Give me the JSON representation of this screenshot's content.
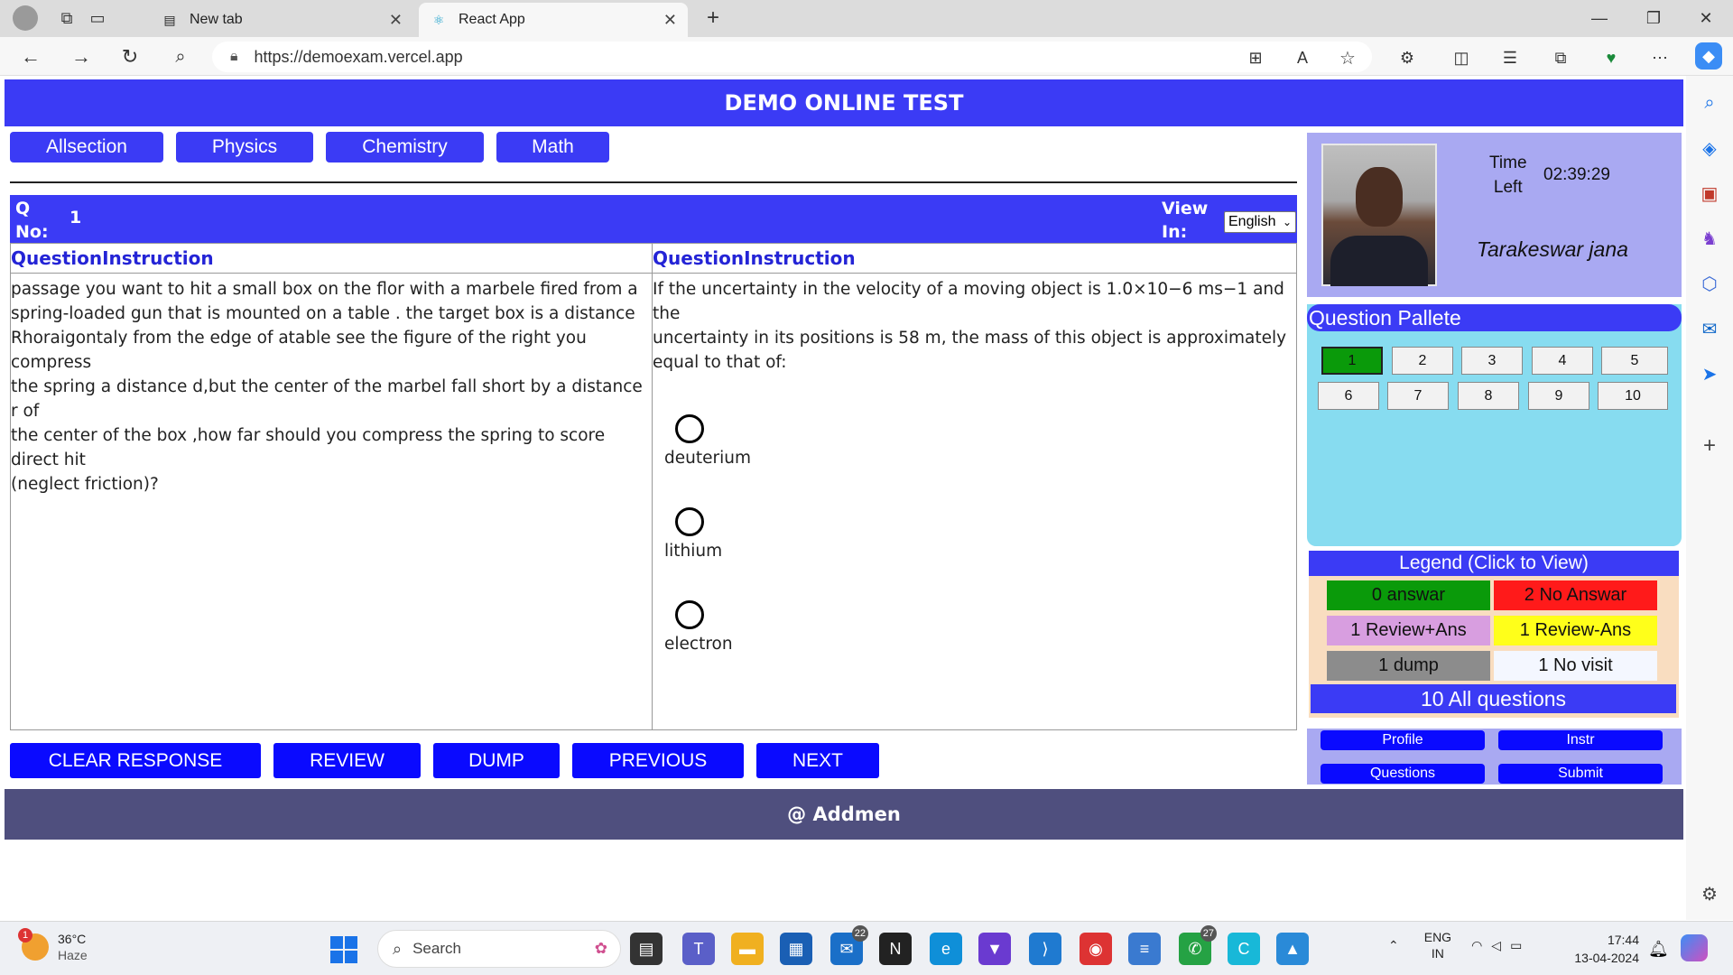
{
  "browser": {
    "tabs": [
      {
        "title": "New tab",
        "active": false
      },
      {
        "title": "React App",
        "active": true
      }
    ],
    "url": "https://demoexam.vercel.app"
  },
  "header": {
    "title": "DEMO ONLINE TEST"
  },
  "sections": [
    "Allsection",
    "Physics",
    "Chemistry",
    "Math"
  ],
  "question_bar": {
    "q_label_line1": "Q",
    "q_label_line2": "No:",
    "q_number": "1",
    "view_label_line1": "View",
    "view_label_line2": "In:",
    "language": "English"
  },
  "left_pane": {
    "title": "QuestionInstruction",
    "text_lines": [
      "passage you want to hit a small box on the flor with a marbele fired from a",
      "spring-loaded gun that is mounted on a table . the target box is a distance",
      "Rhoraigontaly from the edge of atable see the figure of the right you compress",
      "the spring a distance d,but the center of the marbel fall short by a distance r of",
      "the center of the box ,how far should you compress the spring to score direct hit",
      "(neglect friction)?"
    ]
  },
  "right_pane": {
    "title": "QuestionInstruction",
    "text_lines": [
      "If the uncertainty in the velocity of a moving object is 1.0×10−6 ms−1 and the",
      "uncertainty in its positions is 58 m, the mass of this object is approximately",
      "equal to that of:"
    ],
    "options": [
      "deuterium",
      "lithium",
      "electron"
    ]
  },
  "actions": [
    "CLEAR RESPONSE",
    "REVIEW",
    "DUMP",
    "PREVIOUS",
    "NEXT"
  ],
  "profile": {
    "time_label_line1": "Time",
    "time_label_line2": "Left",
    "time_left": "02:39:29",
    "name": "Tarakeswar jana"
  },
  "pallete": {
    "title": "Question Pallete",
    "numbers": [
      "1",
      "2",
      "3",
      "4",
      "5",
      "6",
      "7",
      "8",
      "9",
      "10"
    ]
  },
  "legend": {
    "title": "Legend (Click to View)",
    "items": [
      {
        "label": "0 answar",
        "color": "#0a9a0a"
      },
      {
        "label": "2 No Answar",
        "color": "#ff1a1a"
      },
      {
        "label": "1 Review+Ans",
        "color": "#d89ee0"
      },
      {
        "label": "1 Review-Ans",
        "color": "#ffff1a"
      },
      {
        "label": "1 dump",
        "color": "#8c8c8c"
      },
      {
        "label": "1 No visit",
        "color": "#f4f7ff"
      }
    ],
    "all_questions": "10 All questions"
  },
  "nav_buttons": [
    "Profile",
    "Instr",
    "Questions",
    "Submit"
  ],
  "footer": {
    "text": "@ Addmen"
  },
  "taskbar": {
    "weather_temp": "36°C",
    "weather_desc": "Haze",
    "weather_badge": "1",
    "search_placeholder": "Search",
    "lang_line1": "ENG",
    "lang_line2": "IN",
    "time": "17:44",
    "date": "13-04-2024",
    "badge_mail": "22",
    "badge_whatsapp": "27"
  }
}
